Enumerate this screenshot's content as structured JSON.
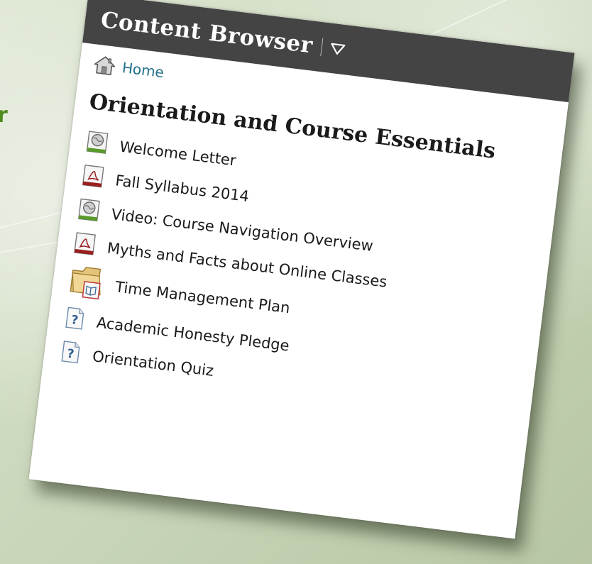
{
  "panel": {
    "title": "Content Browser",
    "menu_icon": "chevron-down-outline-icon"
  },
  "breadcrumb": {
    "home_label": "Home",
    "home_icon": "home-icon"
  },
  "module": {
    "title": "Orientation and Course Essentials"
  },
  "topics": [
    {
      "label": "Welcome Letter",
      "icon": "web-page-icon"
    },
    {
      "label": "Fall Syllabus 2014",
      "icon": "pdf-document-icon"
    },
    {
      "label": "Video: Course Navigation Overview",
      "icon": "web-page-icon"
    },
    {
      "label": "Myths and Facts about Online Classes",
      "icon": "pdf-document-icon"
    },
    {
      "label": "Time Management Plan",
      "icon": "folder-book-icon"
    },
    {
      "label": "Academic Honesty Pledge",
      "icon": "quiz-question-icon"
    },
    {
      "label": "Orientation Quiz",
      "icon": "quiz-question-icon"
    }
  ],
  "background": {
    "edge_letter": "r"
  },
  "colors": {
    "header_bg": "#444444",
    "link": "#1f6f8a",
    "web_icon_bar": "#5a9a2a",
    "pdf_icon_bar": "#9a1f1f",
    "edge_letter": "#4f8a1e"
  }
}
